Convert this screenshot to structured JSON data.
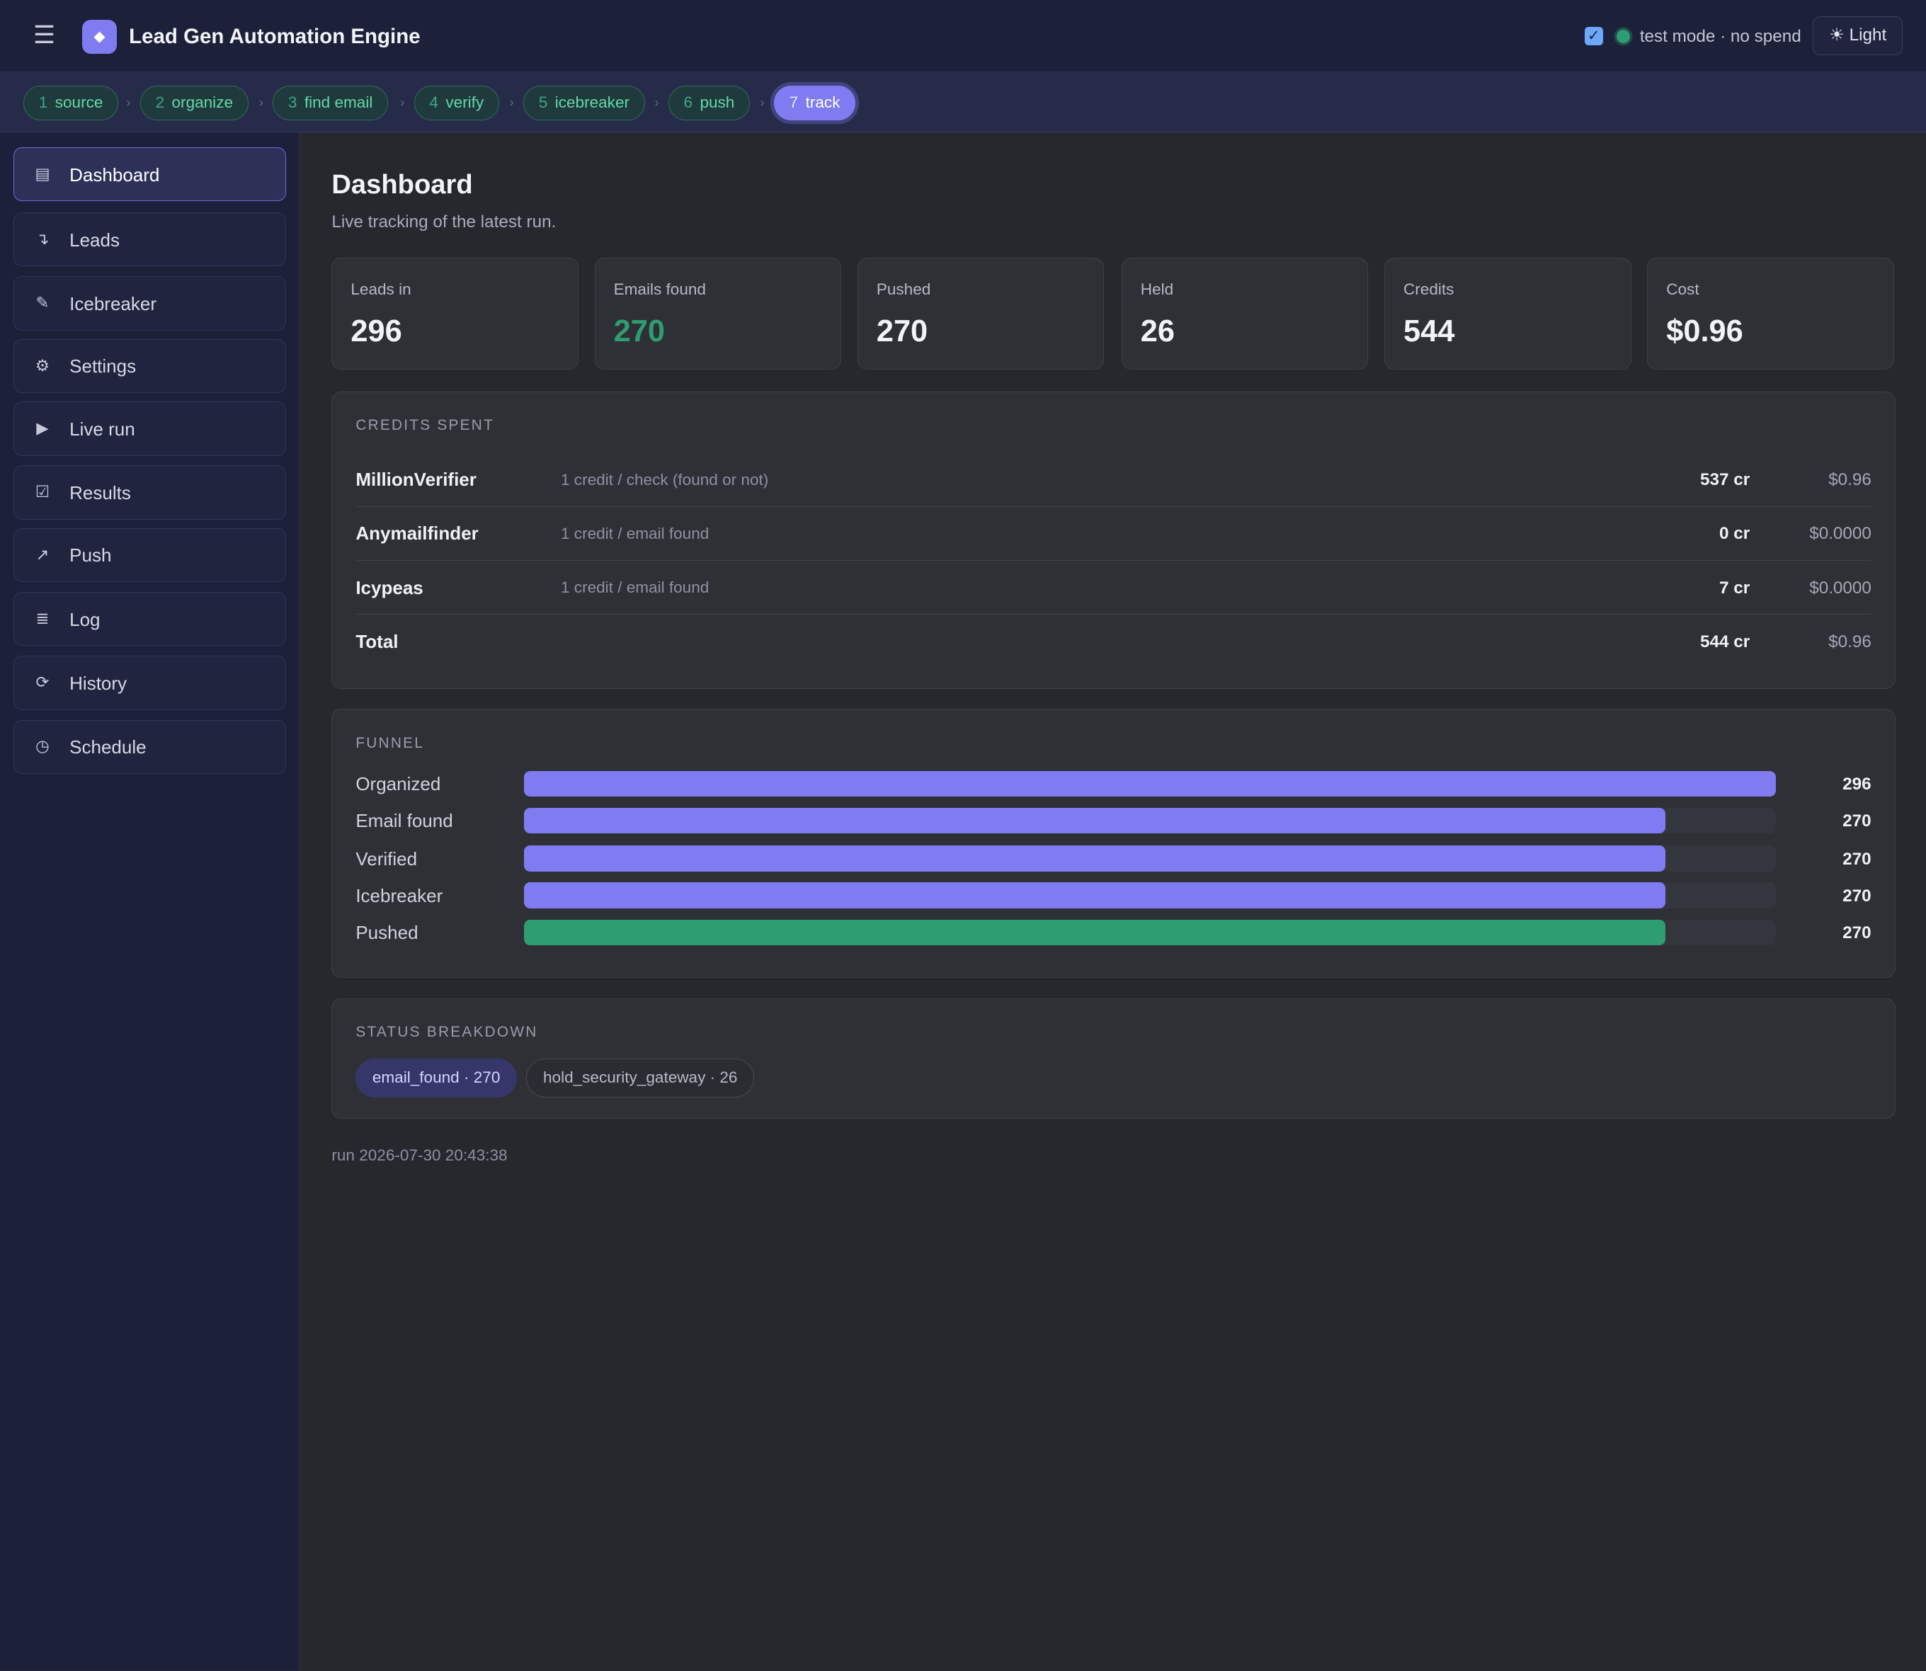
{
  "header": {
    "menu_icon": "hamburger-icon",
    "logo_icon": "diamond-icon",
    "title": "Lead Gen Automation Engine",
    "test_mode_checked": true,
    "mode_text": "test mode · no spend",
    "theme_label": "☀ Light"
  },
  "steps": [
    {
      "num": "1",
      "label": "source"
    },
    {
      "num": "2",
      "label": "organize"
    },
    {
      "num": "3",
      "label": "find email"
    },
    {
      "num": "4",
      "label": "verify"
    },
    {
      "num": "5",
      "label": "icebreaker"
    },
    {
      "num": "6",
      "label": "push"
    },
    {
      "num": "7",
      "label": "track",
      "active": true
    }
  ],
  "sidebar": {
    "items": [
      {
        "label": "Dashboard",
        "icon": "▤",
        "active": true
      },
      {
        "label": "Leads",
        "icon": "↴"
      },
      {
        "label": "Icebreaker",
        "icon": "✎"
      },
      {
        "label": "Settings",
        "icon": "⚙"
      },
      {
        "label": "Live run",
        "icon": "▶"
      },
      {
        "label": "Results",
        "icon": "☑"
      },
      {
        "label": "Push",
        "icon": "↗"
      },
      {
        "label": "Log",
        "icon": "≣"
      },
      {
        "label": "History",
        "icon": "⟳"
      },
      {
        "label": "Schedule",
        "icon": "◷"
      }
    ]
  },
  "main": {
    "title": "Dashboard",
    "subtitle": "Live tracking of the latest run.",
    "kpis": [
      {
        "label": "Leads in",
        "value": "296"
      },
      {
        "label": "Emails found",
        "value": "270",
        "accent": "#2e9d72"
      },
      {
        "label": "Pushed",
        "value": "270"
      },
      {
        "label": "Held",
        "value": "26"
      },
      {
        "label": "Credits",
        "value": "544"
      },
      {
        "label": "Cost",
        "value": "$0.96"
      }
    ],
    "credits": {
      "title": "CREDITS SPENT",
      "rows": [
        {
          "name": "MillionVerifier",
          "desc": "1 credit / check (found or not)",
          "credits": "537 cr",
          "cost": "$0.96"
        },
        {
          "name": "Anymailfinder",
          "desc": "1 credit / email found",
          "credits": "0 cr",
          "cost": "$0.0000"
        },
        {
          "name": "Icypeas",
          "desc": "1 credit / email found",
          "credits": "7 cr",
          "cost": "$0.0000"
        },
        {
          "name": "Total",
          "desc": "",
          "credits": "544 cr",
          "cost": "$0.96"
        }
      ]
    },
    "funnel": {
      "title": "FUNNEL",
      "max": 296,
      "rows": [
        {
          "label": "Organized",
          "value": 296
        },
        {
          "label": "Email found",
          "value": 270
        },
        {
          "label": "Verified",
          "value": 270
        },
        {
          "label": "Icebreaker",
          "value": 270
        },
        {
          "label": "Pushed",
          "value": 270,
          "color": "#2e9d72"
        }
      ]
    },
    "status": {
      "title": "STATUS BREAKDOWN",
      "chips": [
        {
          "label": "email_found · 270"
        },
        {
          "label": "hold_security_gateway · 26"
        }
      ]
    },
    "run_stamp": "run 2026-07-30 20:43:38"
  },
  "colors": {
    "accent": "#7f7cf2",
    "success": "#2e9d72",
    "background": "#26282e",
    "sidebar": "#1c2038"
  }
}
